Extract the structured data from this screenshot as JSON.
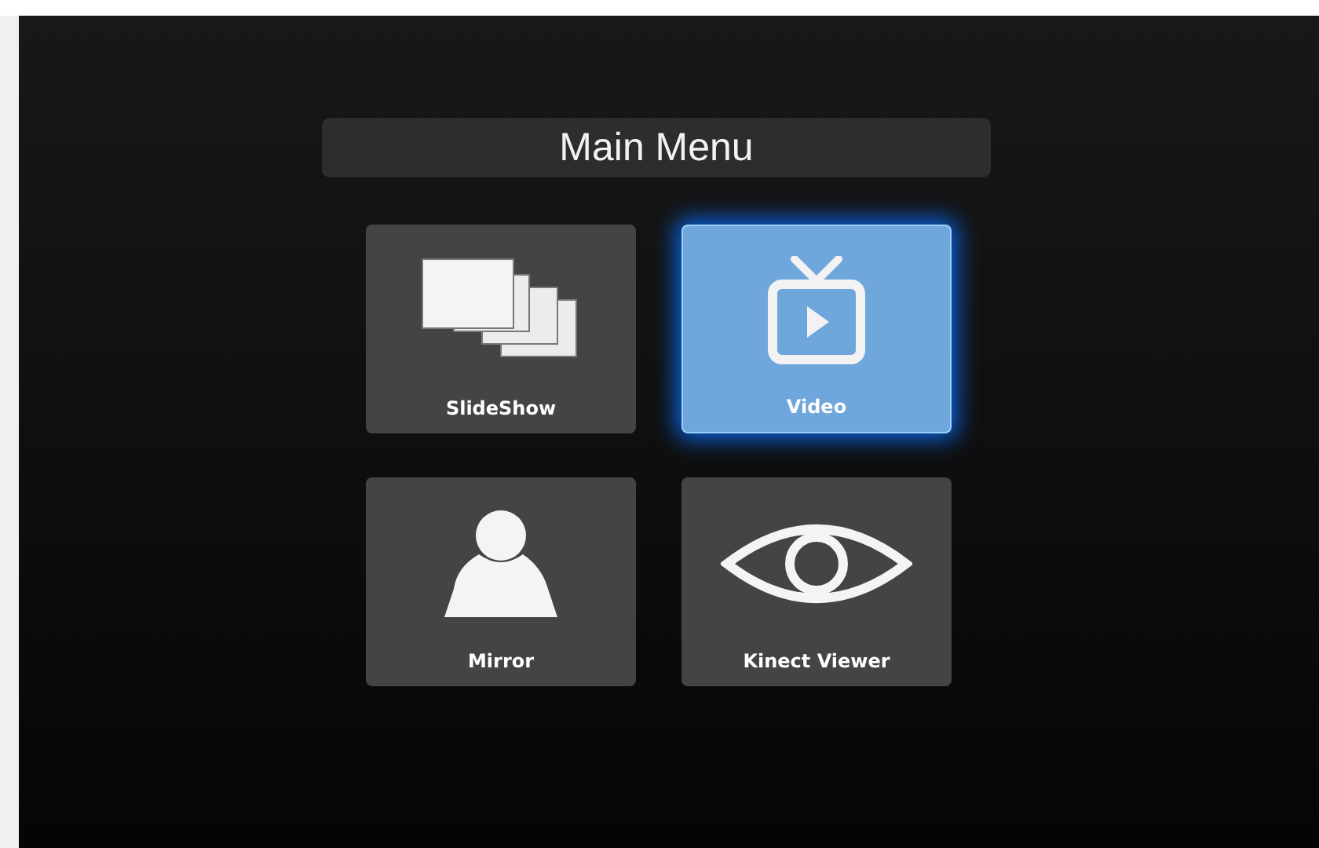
{
  "title": "Main Menu",
  "tiles": [
    {
      "label": "SlideShow",
      "kind": "slides",
      "selected": false
    },
    {
      "label": "Video",
      "kind": "tv",
      "selected": true
    },
    {
      "label": "Mirror",
      "kind": "person",
      "selected": false
    },
    {
      "label": "Kinect Viewer",
      "kind": "eye",
      "selected": false
    }
  ]
}
